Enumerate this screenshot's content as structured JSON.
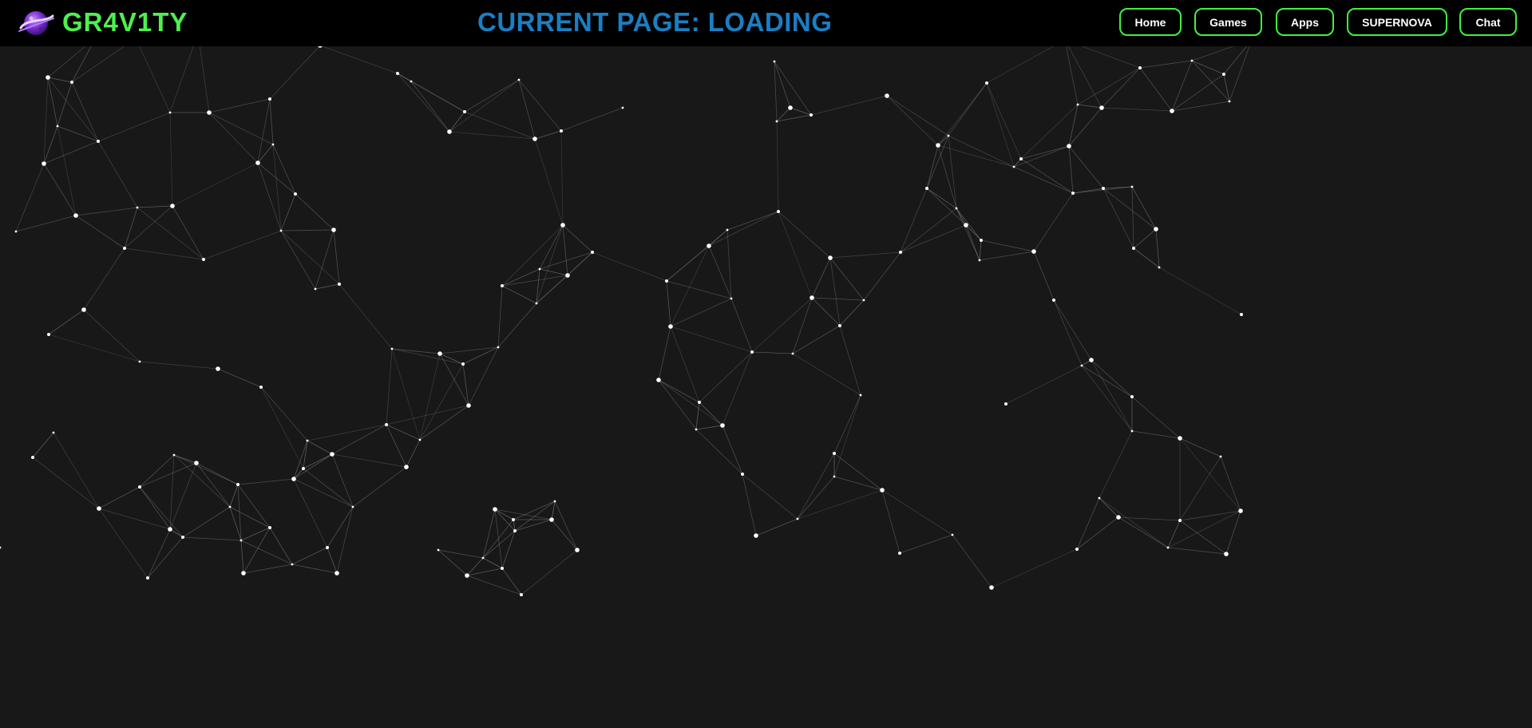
{
  "brand": {
    "name": "GR4V1TY",
    "color": "#4ef04e",
    "logo_icon": "purple-planet-ring-icon"
  },
  "header": {
    "current_page_label": "CURRENT PAGE: LOADING",
    "title_color": "#1a7fc4"
  },
  "nav": {
    "border_color": "#3ff23f",
    "items": [
      {
        "label": "Home"
      },
      {
        "label": "Games"
      },
      {
        "label": "Apps"
      },
      {
        "label": "SUPERNOVA"
      },
      {
        "label": "Chat"
      }
    ]
  },
  "background": {
    "color": "#181818",
    "pattern": "particle-network",
    "node_color": "#ffffff",
    "line_color": "#888888"
  }
}
